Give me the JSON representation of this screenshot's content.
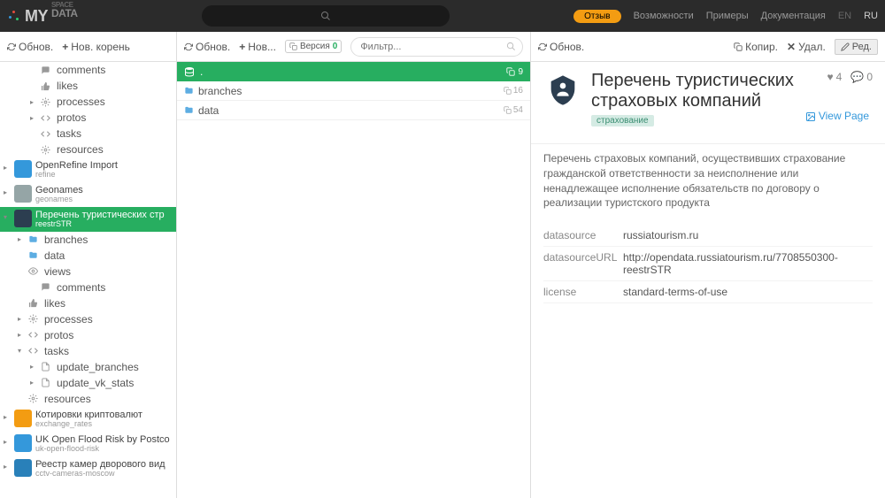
{
  "header": {
    "logo_my": "MY",
    "logo_data": "DATA",
    "logo_space": "SPACE",
    "review": "Отзыв",
    "links": [
      "Возможности",
      "Примеры",
      "Документация"
    ],
    "lang_en": "EN",
    "lang_ru": "RU"
  },
  "col1_toolbar": {
    "refresh": "Обнов.",
    "new_root": "Нов. корень"
  },
  "col2_toolbar": {
    "refresh": "Обнов.",
    "new": "Нов...",
    "version_label": "Версия",
    "version_num": "0",
    "filter_placeholder": "Фильтр..."
  },
  "col3_toolbar": {
    "refresh": "Обнов.",
    "copy": "Копир.",
    "delete": "Удал.",
    "edit": "Ред."
  },
  "tree": {
    "group1": [
      {
        "icon": "comment",
        "label": "comments"
      },
      {
        "icon": "like",
        "label": "likes"
      },
      {
        "icon": "cog",
        "label": "processes",
        "arrow": "▸"
      },
      {
        "icon": "code",
        "label": "protos",
        "arrow": "▸"
      },
      {
        "icon": "code",
        "label": "tasks"
      },
      {
        "icon": "cog",
        "label": "resources"
      }
    ],
    "roots": [
      {
        "title": "OpenRefine Import",
        "sub": "refine",
        "color": "#3498db",
        "arrow": "▸"
      },
      {
        "title": "Geonames",
        "sub": "geonames",
        "color": "#95a5a6",
        "arrow": "▸"
      },
      {
        "title": "Перечень туристических стр",
        "sub": "reestrSTR",
        "color": "#2c3e50",
        "arrow": "▾",
        "selected": true
      }
    ],
    "selected_children": [
      {
        "icon": "folder",
        "label": "branches",
        "arrow": "▸"
      },
      {
        "icon": "folder",
        "label": "data"
      },
      {
        "icon": "eye",
        "label": "views"
      },
      {
        "icon": "comment",
        "label": "comments",
        "indent": 2
      },
      {
        "icon": "like",
        "label": "likes"
      },
      {
        "icon": "cog",
        "label": "processes",
        "arrow": "▸"
      },
      {
        "icon": "code",
        "label": "protos",
        "arrow": "▸"
      },
      {
        "icon": "code",
        "label": "tasks",
        "arrow": "▾"
      },
      {
        "icon": "file",
        "label": "update_branches",
        "indent": 2,
        "arrow": "▸"
      },
      {
        "icon": "file",
        "label": "update_vk_stats",
        "indent": 2,
        "arrow": "▸"
      },
      {
        "icon": "cog",
        "label": "resources"
      }
    ],
    "roots2": [
      {
        "title": "Котировки криптовалют",
        "sub": "exchange_rates",
        "color": "#f39c12",
        "arrow": "▸"
      },
      {
        "title": "UK Open Flood Risk by Postco",
        "sub": "uk-open-flood-risk",
        "color": "#3498db",
        "arrow": "▸"
      },
      {
        "title": "Реестр камер дворового вид",
        "sub": "cctv-cameras-moscow",
        "color": "#2980b9",
        "arrow": "▸"
      }
    ]
  },
  "files": {
    "root": ".",
    "root_count": "9",
    "items": [
      {
        "name": "branches",
        "count": "16"
      },
      {
        "name": "data",
        "count": "54"
      }
    ]
  },
  "detail": {
    "title": "Перечень туристических страховых компаний",
    "hearts": "4",
    "comments": "0",
    "tag": "страхование",
    "view_page": "View Page",
    "description": "Перечень страховых компаний, осуществивших страхование гражданской ответственности за неисполнение или ненадлежащее исполнение обязательств по договору о реализации туристского продукта",
    "rows": [
      {
        "k": "datasource",
        "v": "russiatourism.ru"
      },
      {
        "k": "datasourceURL",
        "v": "http://opendata.russiatourism.ru/7708550300-reestrSTR"
      },
      {
        "k": "license",
        "v": "standard-terms-of-use"
      }
    ]
  }
}
